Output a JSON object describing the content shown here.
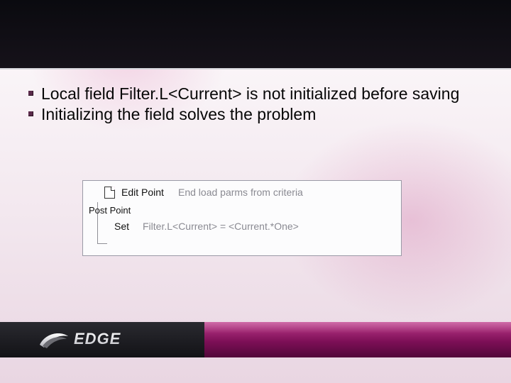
{
  "bullets": [
    "Local field Filter.L<Current>  is not initialized before saving",
    "Initializing the field solves the problem"
  ],
  "code": {
    "row1": {
      "label": "Edit Point",
      "desc": "End load parms from criteria"
    },
    "row2": {
      "label": "Post Point"
    },
    "row3": {
      "set": "Set",
      "expr": "Filter.L<Current> = <Current.*One>"
    }
  },
  "logo": {
    "text": "EDGE"
  }
}
